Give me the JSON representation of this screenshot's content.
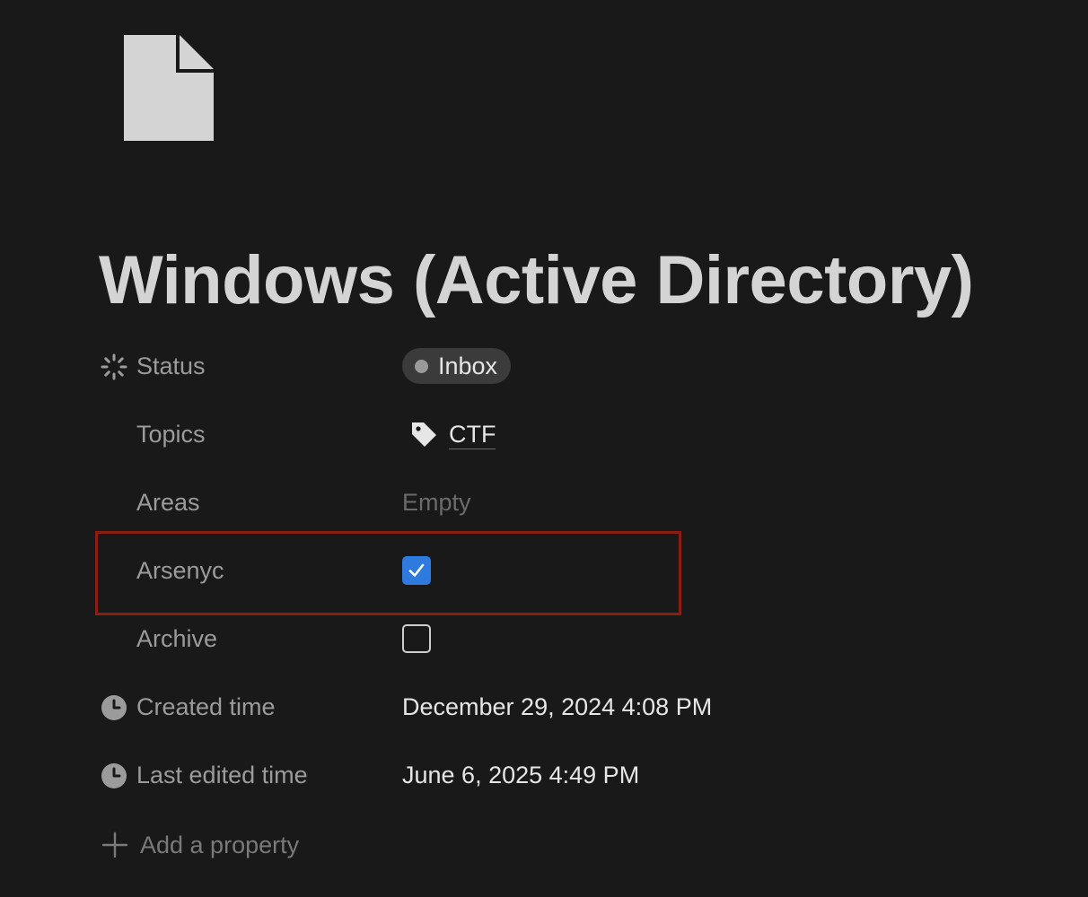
{
  "page": {
    "icon": "document-icon",
    "title": "Windows (Active Directory)"
  },
  "properties": [
    {
      "name": "Status",
      "icon": "status-spinner-icon",
      "value": "Inbox",
      "kind": "status"
    },
    {
      "name": "Topics",
      "icon": "",
      "value": "CTF",
      "value_icon": "tag-icon",
      "kind": "relation"
    },
    {
      "name": "Areas",
      "icon": "",
      "value": "Empty",
      "kind": "empty"
    },
    {
      "name": "Arsenyc",
      "icon": "",
      "checked": true,
      "kind": "checkbox"
    },
    {
      "name": "Archive",
      "icon": "",
      "checked": false,
      "kind": "checkbox"
    },
    {
      "name": "Created time",
      "icon": "clock-icon",
      "value": "December 29, 2024 4:08 PM",
      "kind": "date"
    },
    {
      "name": "Last edited time",
      "icon": "clock-icon",
      "value": "June 6, 2025 4:49 PM",
      "kind": "date"
    }
  ],
  "add_property": {
    "icon": "plus-icon",
    "label": "Add a property"
  },
  "colors": {
    "background": "#191919",
    "checkbox_checked": "#2f7adf",
    "highlight_border": "#8b1e13",
    "status_pill": "#3b3b3b"
  }
}
